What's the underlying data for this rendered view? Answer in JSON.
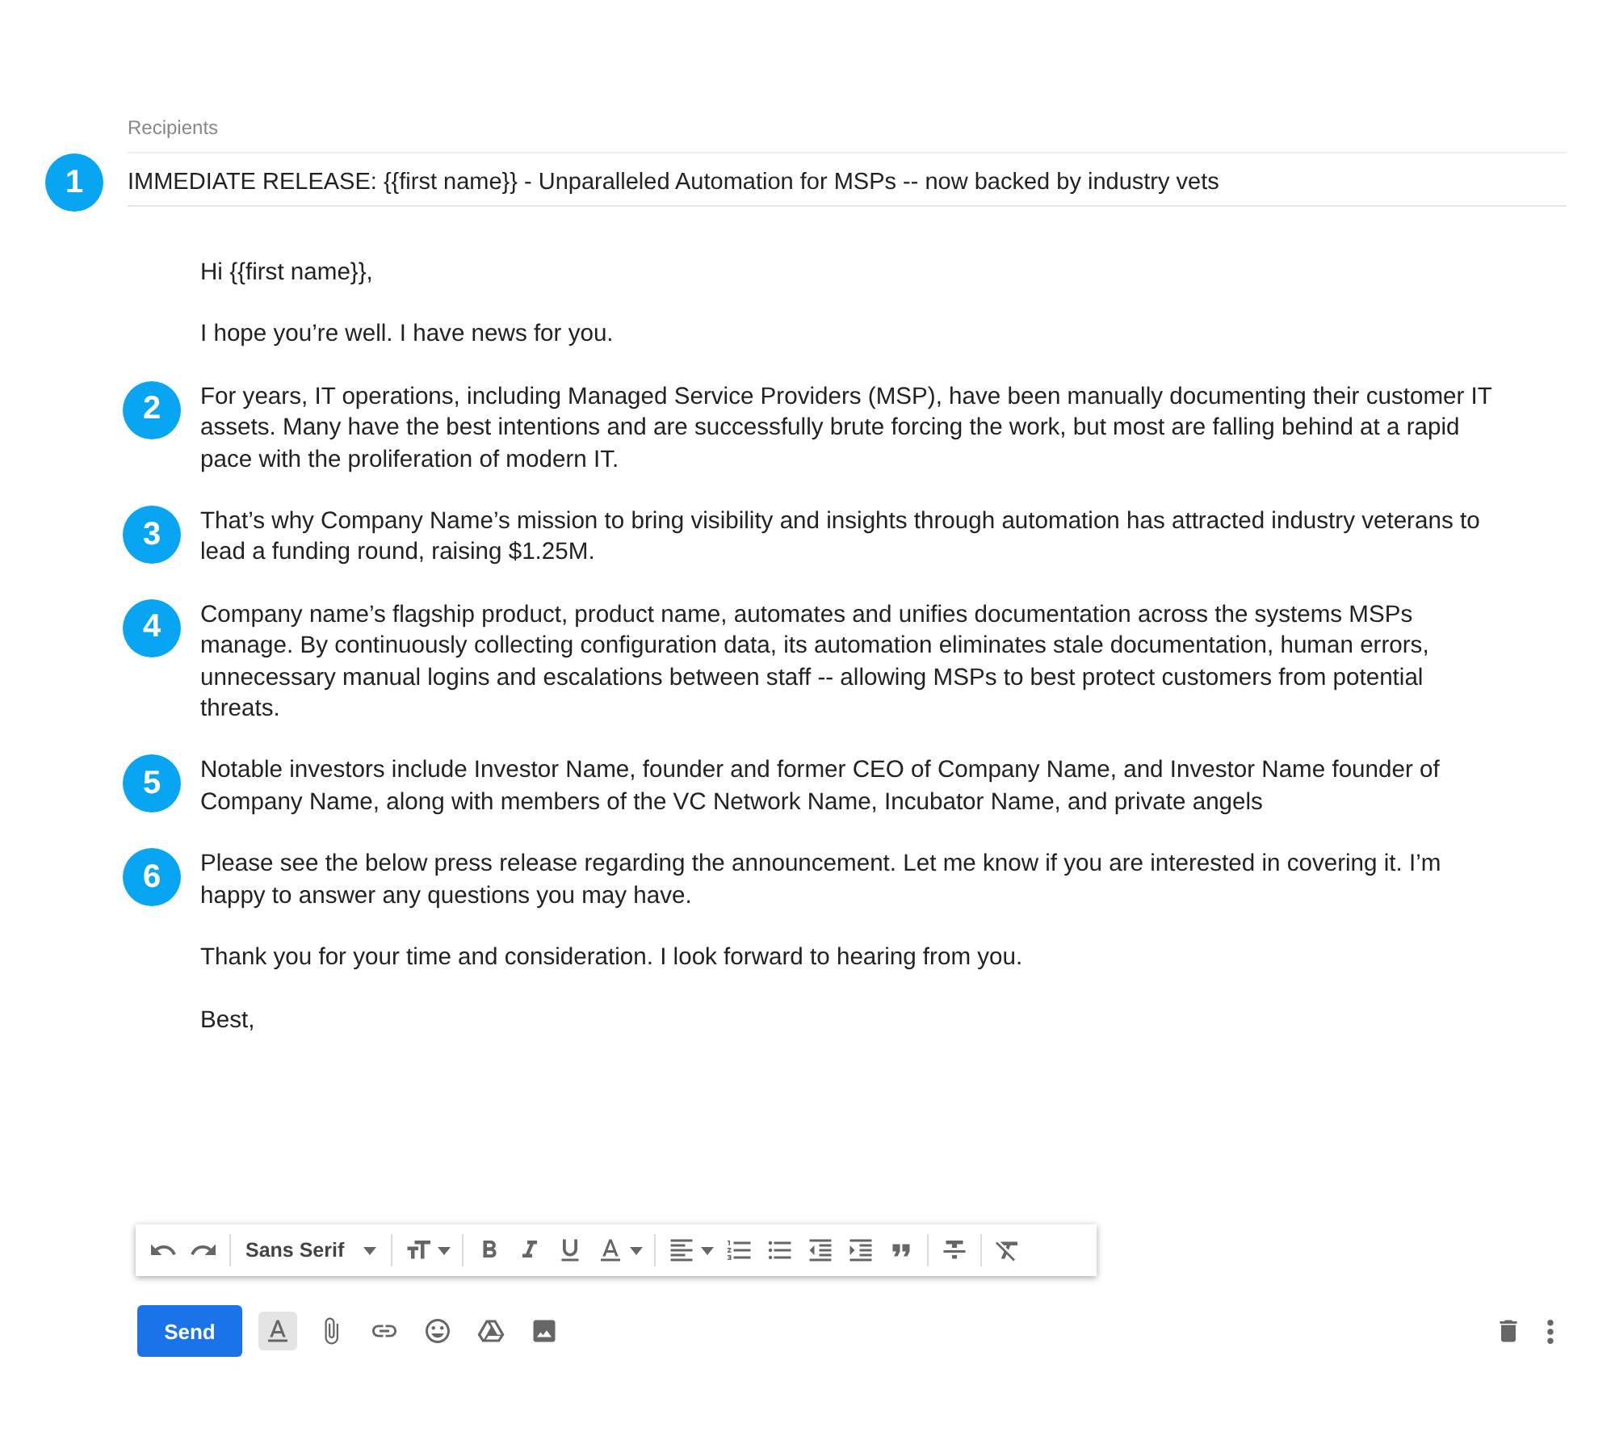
{
  "recipients": {
    "placeholder": "Recipients"
  },
  "subject": {
    "marker": "1",
    "text": "IMMEDIATE RELEASE: {{first name}} - Unparalleled Automation for MSPs -- now backed by industry vets"
  },
  "body": [
    {
      "text": "Hi {{first name}},"
    },
    {
      "text": "I hope you’re well. I have news for you."
    },
    {
      "marker": "2",
      "text": "For years, IT operations, including Managed Service Providers (MSP), have been manually documenting their customer IT assets. Many have the best intentions and are successfully brute forcing the work, but most are falling behind at a rapid pace with the proliferation of modern IT."
    },
    {
      "marker": "3",
      "text": "That’s why Company Name’s mission to bring visibility and insights through automation has attracted industry veterans to lead a funding round, raising $1.25M."
    },
    {
      "marker": "4",
      "text": "Company name’s flagship product, product name, automates and unifies documentation across the systems MSPs manage. By continuously collecting configuration data, its automation eliminates stale documentation, human errors, unnecessary manual logins and escalations between staff -- allowing MSPs to best protect customers from potential threats."
    },
    {
      "marker": "5",
      "text": "Notable investors include Investor Name, founder and former CEO of Company Name, and Investor Name founder of Company Name, along with members of the VC Network Name, Incubator Name, and private angels"
    },
    {
      "marker": "6",
      "text": "Please see the below press release regarding the announcement. Let me know if you are interested in covering it. I’m happy to answer any questions you may have."
    },
    {
      "text": "Thank you for your time and consideration. I look forward to hearing from you."
    },
    {
      "text": "Best,"
    }
  ],
  "toolbar": {
    "font": "Sans Serif"
  },
  "bottom_bar": {
    "send": "Send",
    "formatting_selected": true
  }
}
